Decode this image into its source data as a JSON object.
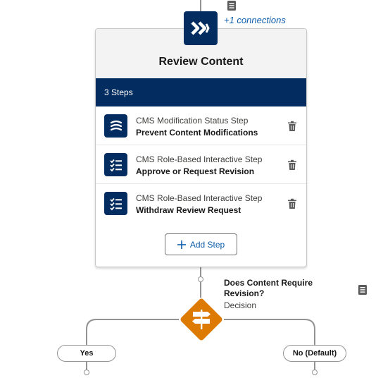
{
  "stage": {
    "icon": "double-chevron-right-icon",
    "connections_label": "+1 connections",
    "title": "Review Content",
    "steps_count_label": "3 Steps",
    "steps": [
      {
        "icon": "modification-status-icon",
        "type": "CMS Modification Status Step",
        "name": "Prevent Content Modifications"
      },
      {
        "icon": "checklist-icon",
        "type": "CMS Role-Based Interactive Step",
        "name": "Approve or Request Revision"
      },
      {
        "icon": "checklist-icon",
        "type": "CMS Role-Based Interactive Step",
        "name": "Withdraw Review Request"
      }
    ],
    "add_step_label": "Add Step"
  },
  "decision": {
    "icon": "decision-signpost-icon",
    "title": "Does Content Require Revision?",
    "type_label": "Decision",
    "branches": [
      {
        "label": "Yes"
      },
      {
        "label": "No (Default)"
      }
    ]
  },
  "colors": {
    "stage_navy": "#032d60",
    "decision_orange": "#dd7a01",
    "link_blue": "#0b5cab",
    "connector_gray": "#939393"
  }
}
